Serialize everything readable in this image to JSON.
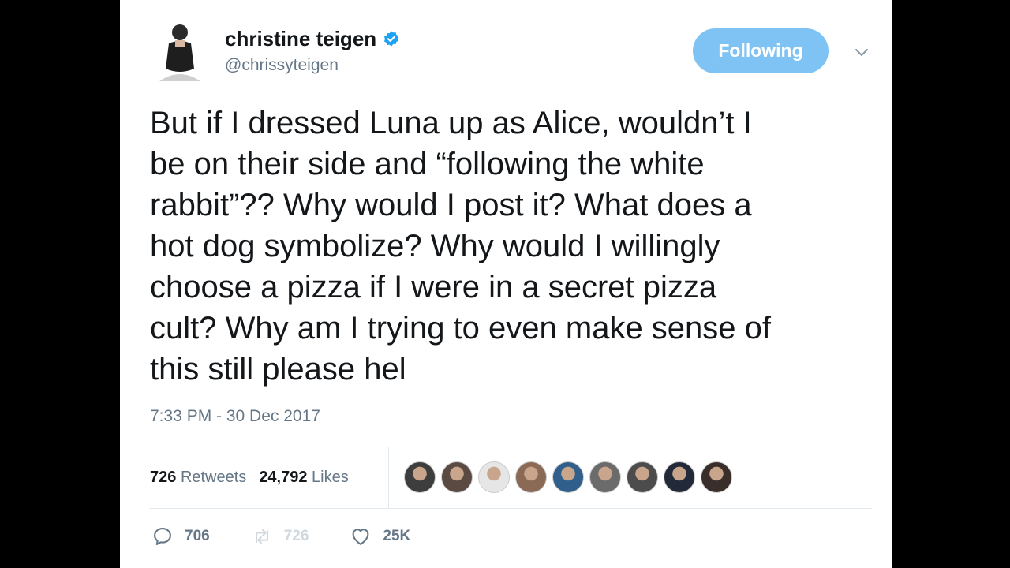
{
  "author": {
    "name": "christine teigen",
    "handle": "@chrissyteigen",
    "verified": true,
    "avatar_icon": "profile-photo"
  },
  "follow_button": {
    "label": "Following",
    "color": "#7fc3f4"
  },
  "menu_icon": "chevron-down-icon",
  "tweet": {
    "text": "But if I dressed Luna up as Alice, wouldn’t I\nbe on their side and “following the white\nrabbit”?? Why would I post it? What does a\nhot dog symbolize? Why would I willingly\nchoose a pizza if I were in a secret pizza\ncult? Why am I trying to even make sense of\nthis still please hel",
    "timestamp": "7:33 PM - 30 Dec 2017"
  },
  "stats": {
    "retweets_count": "726",
    "retweets_label": "Retweets",
    "likes_count": "24,792",
    "likes_label": "Likes"
  },
  "likers": [
    {
      "name": "liker-avatar",
      "color": "#3d3d3d"
    },
    {
      "name": "liker-avatar",
      "color": "#5a4a42"
    },
    {
      "name": "liker-avatar",
      "color": "#e6e6e6"
    },
    {
      "name": "liker-avatar",
      "color": "#8a6a55"
    },
    {
      "name": "liker-avatar",
      "color": "#2f5f8a"
    },
    {
      "name": "liker-avatar",
      "color": "#6b6b6b"
    },
    {
      "name": "liker-avatar",
      "color": "#4c4c4c"
    },
    {
      "name": "liker-avatar",
      "color": "#222a3a"
    },
    {
      "name": "liker-avatar",
      "color": "#3a2e2a"
    }
  ],
  "actions": {
    "reply_count": "706",
    "retweet_count": "726",
    "like_count": "25K"
  },
  "colors": {
    "text": "#14171a",
    "muted": "#657786",
    "verified": "#1da1f2"
  }
}
